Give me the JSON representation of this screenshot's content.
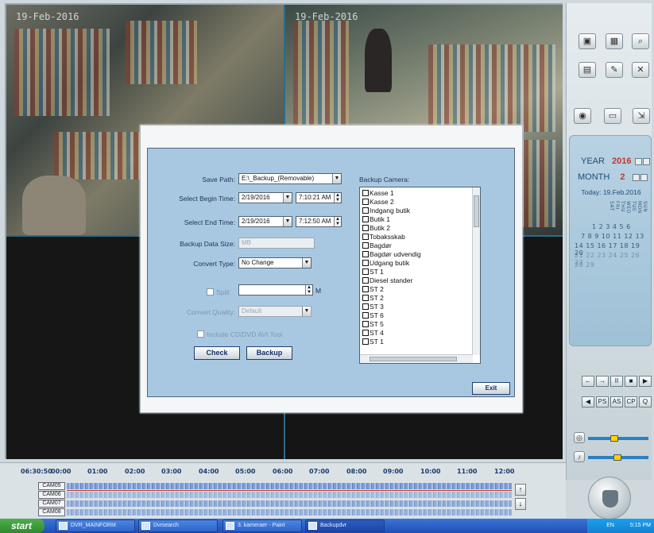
{
  "cameras": [
    {
      "osd": "19-Feb-2016"
    },
    {
      "osd": "19-Feb-2016"
    },
    {
      "osd": ""
    },
    {
      "osd": ""
    }
  ],
  "dialog": {
    "save_path_label": "Save Path:",
    "save_path_value": "E:\\_Backup_(Removable)",
    "begin_time_label": "Select Begin Time:",
    "begin_date": "2/19/2016",
    "begin_time": "7:10:21 AM",
    "end_time_label": "Select End Time:",
    "end_date": "2/19/2016",
    "end_time": "7:12:50 AM",
    "data_size_label": "Backup Data Size:",
    "data_size_value": "MB",
    "convert_type_label": "Convert Type:",
    "convert_type_value": "No Change",
    "split_label": "Split",
    "split_unit": "M",
    "convert_quality_label": "Convert Quality:",
    "convert_quality_value": "Default",
    "include_label": "Include CD/DVD AVI Tool",
    "check_button": "Check",
    "backup_button": "Backup",
    "exit_button": "Exit",
    "camera_list_label": "Backup Camera:",
    "camera_items": [
      "Kasse 1",
      "Kasse 2",
      "Indgang butik",
      "Butik 1",
      "Butik 2",
      "Tobaksskab",
      "Bagdør",
      "Bagdør udvendig",
      "Udgang butik",
      "ST 1",
      "Diesel stander",
      "ST 2",
      "ST 2",
      "ST 3",
      "ST 6",
      "ST 5",
      "ST 4",
      "ST 1"
    ]
  },
  "calendar": {
    "year_label": "YEAR",
    "year_value": "2016",
    "month_label": "MONTH",
    "month_value": "2",
    "today_label": "Today: 19.Feb.2016",
    "weekday_header": "SUN MON TUE WED THU FRI SAT",
    "weeks": [
      "1 2 3 4 5 6",
      "7 8 9 10 11 12 13",
      "14 15 16 17 18 19 20",
      "21 22 23 24 25 26 27",
      "28 29"
    ]
  },
  "timeline": {
    "current_time": "06:30:50",
    "ticks": [
      "00:00",
      "01:00",
      "02:00",
      "03:00",
      "04:00",
      "05:00",
      "06:00",
      "07:00",
      "08:00",
      "09:00",
      "10:00",
      "11:00",
      "12:00"
    ],
    "channels": [
      "CAM05",
      "CAM06",
      "CAM07",
      "CAM08"
    ]
  },
  "player_buttons": [
    "←",
    "→",
    "II",
    "■",
    "▶",
    "◀",
    "PS",
    "AS",
    "CP",
    "Q"
  ],
  "taskbar": {
    "start": "start",
    "tasks": [
      "DVR_MAINFORM",
      "Dvrsearch",
      "3. kameraer - Paint",
      "Backupdvr"
    ],
    "tray_lang": "EN",
    "tray_time": "5:15 PM"
  },
  "colors": {
    "dialog_bg": "#a8c8e2",
    "accent_blue": "#1f4fb4",
    "calendar_bg": "#9fc1d6",
    "highlight_day": "#3a9a3a"
  }
}
